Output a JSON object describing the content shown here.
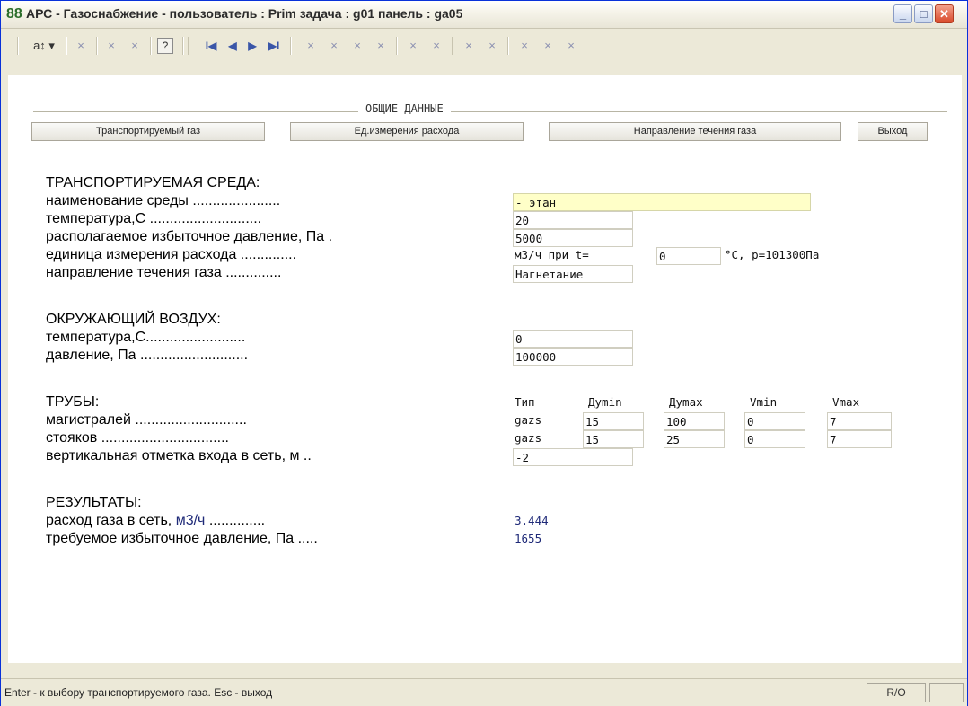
{
  "window": {
    "title": "АРС - Газоснабжение -  пользователь : Prim  задача : g01  панель : ga05",
    "app_icon": "88",
    "minimize_label": "_",
    "maximize_label": "□",
    "close_label": "✕"
  },
  "toolbar": {
    "sort_label": "a↕ ▾",
    "x": "×",
    "help": "?",
    "first": "I◀",
    "prev": "◀",
    "next": "▶",
    "last": "▶I"
  },
  "group": {
    "title": "ОБЩИЕ ДАННЫЕ"
  },
  "tabs": [
    {
      "label": "Транспортируемый газ"
    },
    {
      "label": "Ед.измерения расхода"
    },
    {
      "label": "Направление течения газа"
    },
    {
      "label": "Выход"
    }
  ],
  "medium": {
    "heading": "ТРАНСПОРТИРУЕМАЯ СРЕДА:",
    "name_label": "наименование среды ......................",
    "name_value": "- этан",
    "temp_label": "температура,С ............................",
    "temp_value": "20",
    "pressure_label": "располагаемое избыточное давление, Па .",
    "pressure_value": "5000",
    "unit_label": "единица измерения расхода ..............",
    "unit_value": "м3/ч при t=",
    "unit_t_value": "0",
    "unit_suffix": "°С, р=101300Па",
    "direction_label": "направление течения газа ..............",
    "direction_value": "Нагнетание"
  },
  "air": {
    "heading": "ОКРУЖАЮЩИЙ ВОЗДУХ:",
    "temp_label": "температура,С.........................",
    "temp_value": "0",
    "pressure_label": "давление, Па ...........................",
    "pressure_value": "100000"
  },
  "pipes": {
    "heading": "ТРУБЫ:",
    "columns": [
      "Тип",
      "Дуmin",
      "Дуmax",
      "Vmin",
      "Vmax"
    ],
    "main_label": "магистралей ............................",
    "main": [
      "gazs",
      "15",
      "100",
      "0",
      "7"
    ],
    "risers_label": "стояков ................................",
    "risers": [
      "gazs",
      "15",
      "25",
      "0",
      "7"
    ],
    "elevation_label": "вертикальная отметка входа в сеть, м ..",
    "elevation_value": "-2"
  },
  "results": {
    "heading": "РЕЗУЛЬТАТЫ:",
    "flow_label": "расход газа в сеть, ",
    "flow_unit": "м3/ч",
    "flow_dots": " ..............",
    "flow_value": "3.444",
    "pressure_label": "требуемое избыточное давление, Па .....",
    "pressure_value": "1655"
  },
  "status": {
    "text": "Enter - к выбору транспортируемого газа. Esc - выход",
    "mode": "R/O"
  }
}
